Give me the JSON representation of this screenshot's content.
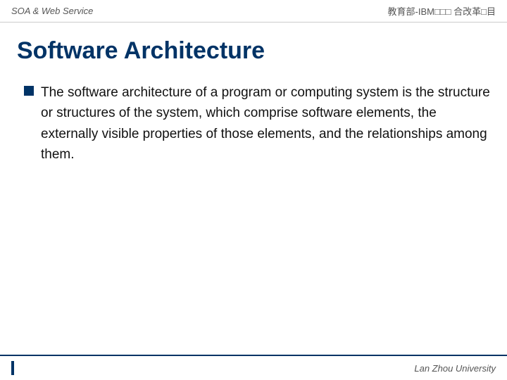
{
  "header": {
    "left_text": "SOA & Web Service",
    "right_text": "教育部-IBM□□□ 合改革□目"
  },
  "page": {
    "title": "Software Architecture",
    "bullet": {
      "text": "The software architecture of a program or computing system is the structure or structures of the system, which comprise software elements, the externally visible properties of those elements, and the relationships among them."
    }
  },
  "footer": {
    "university": "Lan Zhou University"
  }
}
